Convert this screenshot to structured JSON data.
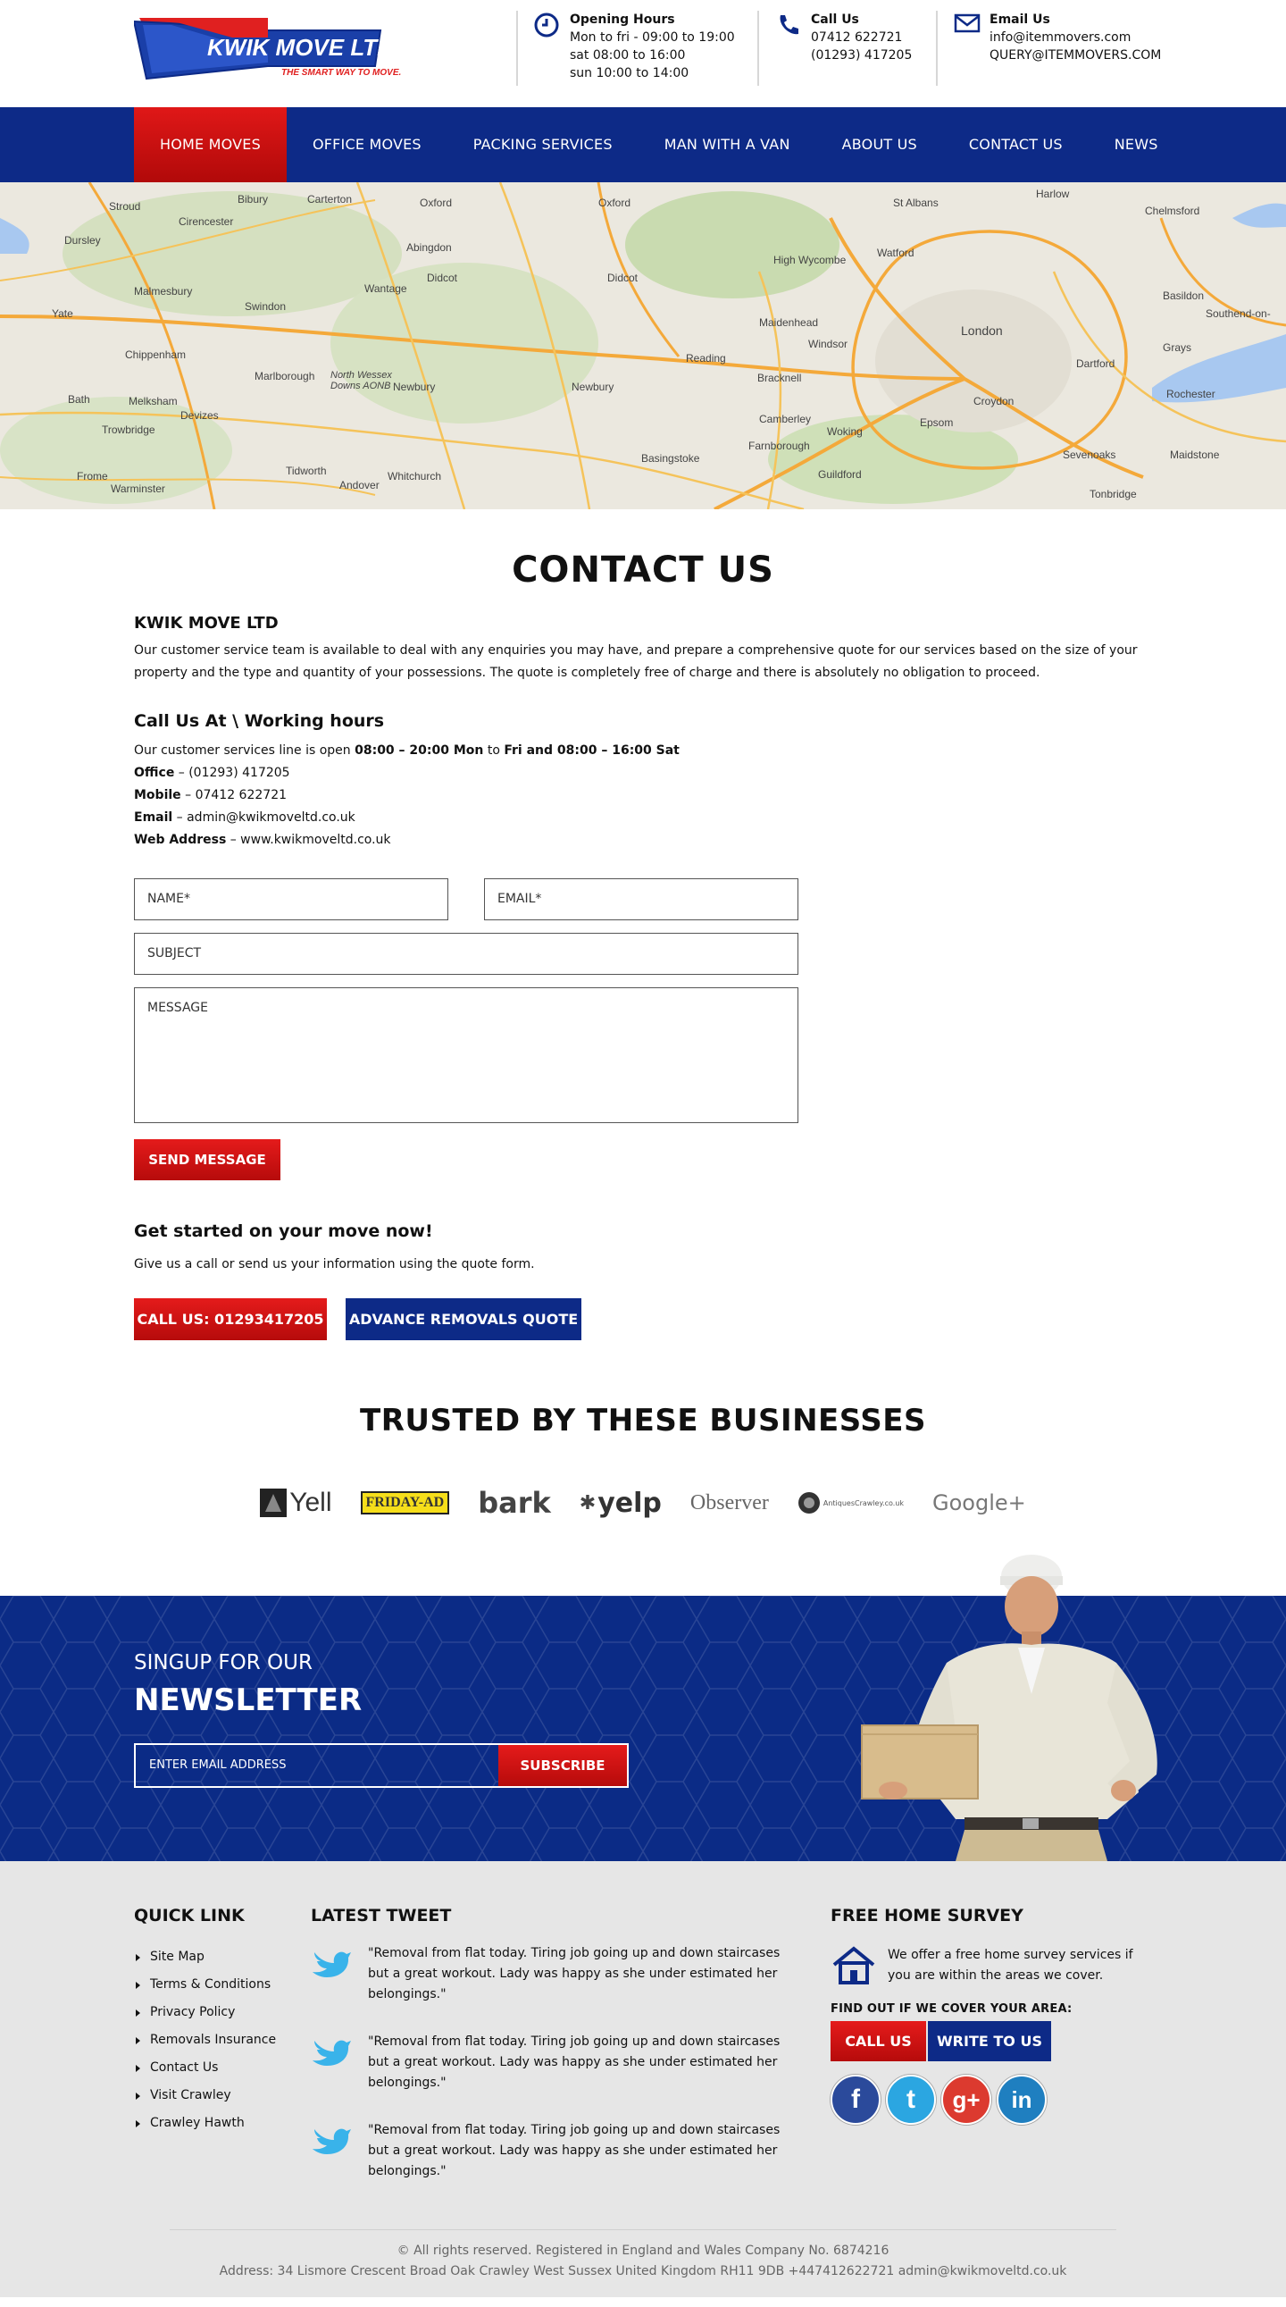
{
  "header": {
    "logo": {
      "name": "KWIK MOVE LTD",
      "tagline": "THE SMART WAY TO MOVE."
    },
    "opening": {
      "title": "Opening Hours",
      "lines": [
        "Mon to fri - 09:00  to 19:00",
        "sat 08:00  to 16:00",
        "sun 10:00 to 14:00"
      ]
    },
    "call": {
      "title": "Call Us",
      "lines": [
        "07412 622721",
        "(01293) 417205"
      ]
    },
    "email": {
      "title": "Email Us",
      "lines": [
        "info@itemmovers.com",
        "QUERY@ITEMMOVERS.COM"
      ]
    }
  },
  "nav": [
    "HOME MOVES",
    "OFFICE MOVES",
    "PACKING SERVICES",
    "MAN WITH A VAN",
    "ABOUT US",
    "CONTACT US",
    "NEWS"
  ],
  "map": {
    "labels": [
      "Stroud",
      "Oxford",
      "Oxford",
      "St Albans",
      "Harlow",
      "Chelmsford",
      "Cirencester",
      "Abingdon",
      "High Wycombe",
      "Watford",
      "Swindon",
      "Didcot",
      "Didcot",
      "Malmesbury",
      "Wantage",
      "Maidenhead",
      "London",
      "Basildon",
      "Southend-on-",
      "Chippenham",
      "Reading",
      "Windsor",
      "Dartford",
      "Grays",
      "Marlborough",
      "Newbury",
      "Newbury",
      "Bracknell",
      "Croydon",
      "Rochester",
      "Bath",
      "Melksham",
      "Devizes",
      "North Wessex Downs AONB",
      "Camberley",
      "Woking",
      "Epsom",
      "Maidstone",
      "Trowbridge",
      "Basingstoke",
      "Farnborough",
      "Guildford",
      "Sevenoaks",
      "Frome",
      "Warminster",
      "Andover",
      "Tidworth",
      "Whitchurch",
      "Tonbridge",
      "Yate",
      "Dursley",
      "Carterton",
      "Bibury"
    ]
  },
  "contact": {
    "title": "CONTACT US",
    "company": "KWIK MOVE LTD",
    "intro": "Our customer service team is available to deal with any enquiries you may have, and prepare a comprehensive quote for our services based on the size of your property and the type and quantity of your possessions. The quote is completely free of charge and there is absolutely no obligation to proceed.",
    "heading": "Call Us At  \\  Working hours",
    "line_pre": "Our customer services line is open ",
    "line_b1": "08:00 – 20:00 Mon",
    "line_mid": " to ",
    "line_b2": "Fri and 08:00 – 16:00 Sat",
    "office_label": "Office",
    "office_value": " – (01293) 417205",
    "mobile_label": "Mobile",
    "mobile_value": " – 07412 622721",
    "email_label": "Email",
    "email_value": " – admin@kwikmoveltd.co.uk",
    "web_label": "Web Address",
    "web_value": " – www.kwikmoveltd.co.uk"
  },
  "form": {
    "name": "NAME*",
    "email": "EMAIL*",
    "subject": "SUBJECT",
    "message": "MESSAGE",
    "send": "SEND MESSAGE"
  },
  "getstarted": {
    "title": "Get started on your move now!",
    "text": "Give us a call or send us your information using the quote form.",
    "call_btn": "CALL US: 01293417205",
    "quote_btn": "ADVANCE REMOVALS QUOTE"
  },
  "trusted": {
    "title": "TRUSTED BY THESE BUSINESSES",
    "logos": [
      "Yell",
      "FRIDAY-AD",
      "bark",
      "yelp",
      "Observer",
      "AntiquesCrawley.co.uk",
      "Google+"
    ]
  },
  "newsletter": {
    "small": "SINGUP FOR OUR",
    "big": "NEWSLETTER",
    "placeholder": "ENTER EMAIL ADDRESS",
    "subscribe": "SUBSCRIBE"
  },
  "footer": {
    "quick_title": "QUICK LINK",
    "quick_links": [
      "Site Map",
      "Terms & Conditions",
      "Privacy Policy",
      "Removals Insurance",
      "Contact Us",
      "Visit Crawley",
      "Crawley Hawth"
    ],
    "tweet_title": "LATEST TWEET",
    "tweets": [
      "\"Removal from flat today. Tiring job going up and down staircases but a great workout. Lady was happy as she under estimated her belongings.\"",
      "\"Removal from flat today. Tiring job going up and down staircases but a great workout. Lady was happy as she under estimated her belongings.\"",
      "\"Removal from flat today. Tiring job going up and down staircases but a great workout. Lady was happy as she under estimated her belongings.\""
    ],
    "survey_title": "FREE HOME SURVEY",
    "survey_text": "We offer a free home survey services if you are within the areas we cover.",
    "findout": "FIND OUT IF WE COVER YOUR AREA:",
    "call_btn": "CALL US",
    "write_btn": "WRITE TO US",
    "socials": [
      {
        "name": "facebook",
        "glyph": "f",
        "color": "#2b4a9b"
      },
      {
        "name": "twitter",
        "glyph": "t",
        "color": "#2ba6e1"
      },
      {
        "name": "google-plus",
        "glyph": "g+",
        "color": "#dc3a2f"
      },
      {
        "name": "linkedin",
        "glyph": "in",
        "color": "#1f7fc0"
      }
    ],
    "copyright": "© All rights reserved. Registered in England and Wales Company No. 6874216",
    "address": "Address: 34 Lismore Crescent Broad Oak Crawley West Sussex United Kingdom RH11 9DB +447412622721 admin@kwikmoveltd.co.uk"
  },
  "colors": {
    "brand_blue": "#0d2a87",
    "brand_red": "#d41212"
  }
}
